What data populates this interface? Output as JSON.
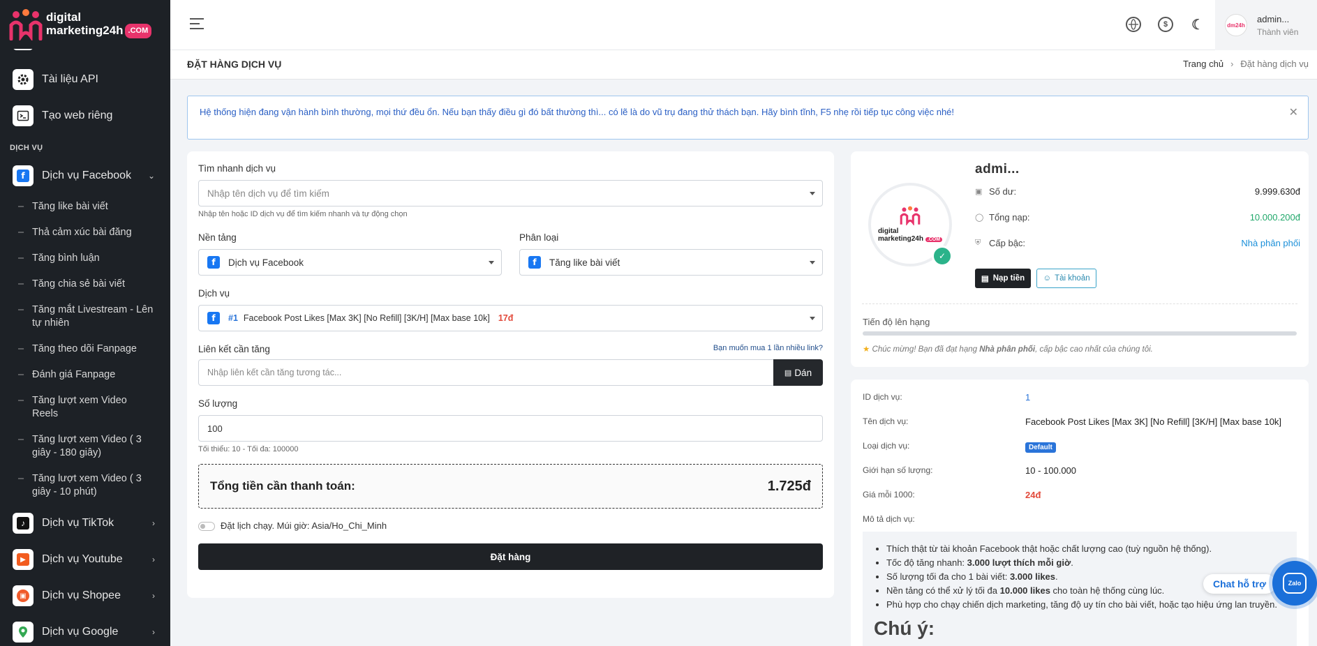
{
  "brand": {
    "line1": "digital",
    "line2": "marketing24h",
    "com": ".COM"
  },
  "sidebar": {
    "top_items": [
      {
        "label": "Tài liệu API",
        "icon": "gear-icon"
      },
      {
        "label": "Tạo web riêng",
        "icon": "terminal-icon"
      }
    ],
    "section_label": "DỊCH VỤ",
    "facebook": {
      "label": "Dịch vụ Facebook",
      "icon": "facebook-icon"
    },
    "facebook_subs": [
      "Tăng like bài viết",
      "Thả cảm xúc bài đăng",
      "Tăng bình luận",
      "Tăng chia sẻ bài viết",
      "Tăng mắt Livestream - Lên tự nhiên",
      "Tăng theo dõi Fanpage",
      "Đánh giá Fanpage",
      "Tăng lượt xem Video Reels",
      "Tăng lượt xem Video ( 3 giây - 180 giây)",
      "Tăng lượt xem Video ( 3 giây - 10 phút)"
    ],
    "other_services": [
      {
        "label": "Dịch vụ TikTok",
        "icon": "tiktok-icon"
      },
      {
        "label": "Dịch vụ Youtube",
        "icon": "youtube-icon"
      },
      {
        "label": "Dịch vụ Shopee",
        "icon": "shopee-icon"
      },
      {
        "label": "Dịch vụ Google",
        "icon": "google-icon"
      }
    ]
  },
  "topbar": {
    "user_name": "admin...",
    "user_role": "Thành viên"
  },
  "page": {
    "title": "ĐẶT HÀNG DỊCH VỤ",
    "breadcrumb_home": "Trang chủ",
    "breadcrumb_current": "Đặt hàng dịch vụ"
  },
  "alert": {
    "text": "Hệ thống hiện đang vận hành bình thường, mọi thứ đều ổn. Nếu bạn thấy điều gì đó bất thường thì... có lẽ là do vũ trụ đang thử thách bạn. Hãy bình tĩnh, F5 nhẹ rồi tiếp tục công việc nhé!"
  },
  "form": {
    "search_label": "Tìm nhanh dịch vụ",
    "search_placeholder": "Nhập tên dịch vụ để tìm kiếm",
    "search_help": "Nhập tên hoặc ID dịch vụ để tìm kiếm nhanh và tự động chọn",
    "platform_label": "Nền tảng",
    "platform_value": "Dịch vụ Facebook",
    "category_label": "Phân loại",
    "category_value": "Tăng like bài viết",
    "service_label": "Dịch vụ",
    "service_id": "#1",
    "service_name": "Facebook Post Likes [Max 3K] [No Refill] [3K/H] [Max base 10k]",
    "service_price": "17đ",
    "link_label": "Liên kết cần tăng",
    "link_multi": "Bạn muốn mua 1 lần nhiều link?",
    "link_placeholder": "Nhập liên kết cần tăng tương tác...",
    "paste_label": "Dán",
    "qty_label": "Số lượng",
    "qty_value": "100",
    "qty_help": "Tối thiểu: 10 - Tối đa: 100000",
    "total_label": "Tổng tiền cần thanh toán:",
    "total_value": "1.725đ",
    "schedule_label": "Đặt lịch chạy. Múi giờ: Asia/Ho_Chi_Minh",
    "order_button": "Đặt hàng"
  },
  "profile": {
    "name": "admi...",
    "balance_label": "Số dư:",
    "balance_value": "9.999.630đ",
    "deposit_label": "Tổng nạp:",
    "deposit_value": "10.000.200đ",
    "rank_label": "Cấp bậc:",
    "rank_value": "Nhà phân phối",
    "topup_button": "Nạp tiền",
    "account_button": "Tài khoản",
    "progress_label": "Tiến độ lên hạng",
    "progress_fraction": 1.0,
    "congrats_prefix": "Chúc mừng! Bạn đã đạt hạng ",
    "congrats_rank": "Nhà phân phối",
    "congrats_suffix": ", cấp bậc cao nhất của chúng tôi."
  },
  "details": {
    "id_label": "ID dịch vụ:",
    "id_value": "1",
    "name_label": "Tên dịch vụ:",
    "name_value": "Facebook Post Likes [Max 3K] [No Refill] [3K/H] [Max base 10k]",
    "type_label": "Loại dịch vụ:",
    "type_value": "Default",
    "limit_label": "Giới hạn số lượng:",
    "limit_value": "10 - 100.000",
    "price_label": "Giá mỗi 1000:",
    "price_value": "24đ",
    "desc_label": "Mô tả dịch vụ:",
    "desc_items": [
      {
        "pre": "Thích thật từ tài khoản Facebook thật hoặc chất lượng cao (tuỳ nguồn hệ thống).",
        "bold": "",
        "post": ""
      },
      {
        "pre": "Tốc độ tăng nhanh: ",
        "bold": "3.000 lượt thích mỗi giờ",
        "post": "."
      },
      {
        "pre": "Số lượng tối đa cho 1 bài viết: ",
        "bold": "3.000 likes",
        "post": "."
      },
      {
        "pre": "Nền tảng có thể xử lý tối đa ",
        "bold": "10.000 likes",
        "post": " cho toàn hệ thống cùng lúc."
      },
      {
        "pre": "Phù hợp cho chạy chiến dịch marketing, tăng độ uy tín cho bài viết, hoặc tạo hiệu ứng lan truyền.",
        "bold": "",
        "post": ""
      }
    ],
    "note_title": "Chú ý:"
  },
  "chat": {
    "pill_label": "Chat hỗ trợ",
    "bubble_label": "Zalo"
  },
  "colors": {
    "sidebar_bg": "#1d2126",
    "accent_red": "#e8336b",
    "link_blue": "#1a6fd9",
    "green": "#21a86b",
    "price_red": "#e24a3b"
  }
}
